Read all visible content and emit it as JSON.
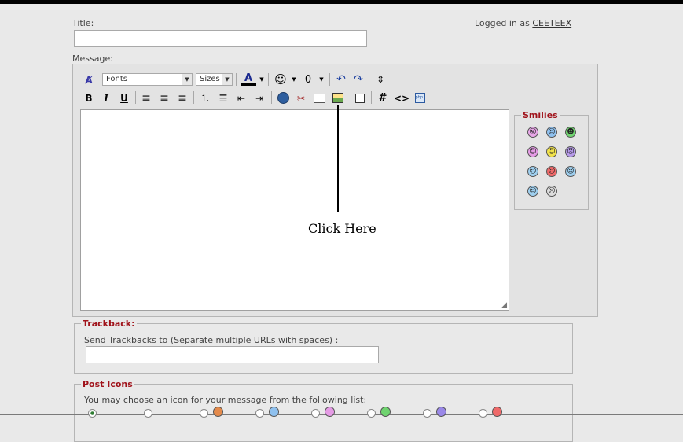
{
  "form": {
    "title_label": "Title:",
    "message_label": "Message:",
    "logged_in_prefix": "Logged in as",
    "username": "CEETEEX"
  },
  "toolbar": {
    "fonts_value": "Fonts",
    "sizes_value": "Sizes",
    "bold": "B",
    "italic": "I",
    "underline": "U",
    "hash": "#",
    "code": "<>",
    "swap": "⇕"
  },
  "smilies": {
    "legend": "Smilies",
    "items": [
      {
        "name": "tongue",
        "color": "#e7a6e7",
        "glyph": "😛"
      },
      {
        "name": "cool",
        "color": "#8fc1ef",
        "glyph": "☺"
      },
      {
        "name": "grin",
        "color": "#6fd36f",
        "glyph": "☻"
      },
      {
        "name": "happy",
        "color": "#e59be5",
        "glyph": "☺"
      },
      {
        "name": "smile",
        "color": "#f1e24a",
        "glyph": "☺"
      },
      {
        "name": "sad",
        "color": "#b69ae9",
        "glyph": "☹"
      },
      {
        "name": "confused",
        "color": "#9ecfef",
        "glyph": "☹"
      },
      {
        "name": "mad",
        "color": "#ef6a6a",
        "glyph": "☹"
      },
      {
        "name": "roll",
        "color": "#9ecfef",
        "glyph": "☺"
      },
      {
        "name": "shades",
        "color": "#9ecfef",
        "glyph": "☺"
      },
      {
        "name": "eek",
        "color": "#dddddd",
        "glyph": "☹"
      }
    ]
  },
  "callout": {
    "label": "Click Here"
  },
  "trackback": {
    "legend": "Trackback:",
    "description": "Send Trackbacks to (Separate multiple URLs with spaces) :"
  },
  "post_icons": {
    "legend": "Post Icons",
    "description": "You may choose an icon for your message from the following list:",
    "icons": [
      {
        "name": "none",
        "color": "#ffffff"
      },
      {
        "name": "blank",
        "color": "#e9e9e9"
      },
      {
        "name": "thumbs",
        "color": "#e48a4b"
      },
      {
        "name": "cool",
        "color": "#8fc1ef"
      },
      {
        "name": "happy",
        "color": "#e59be5"
      },
      {
        "name": "grin",
        "color": "#6fd36f"
      },
      {
        "name": "sad",
        "color": "#9a88e8"
      },
      {
        "name": "mad",
        "color": "#ef6a6a"
      }
    ]
  },
  "colors": {
    "accent": "#a0131b",
    "font_color_bar": "#000000"
  }
}
